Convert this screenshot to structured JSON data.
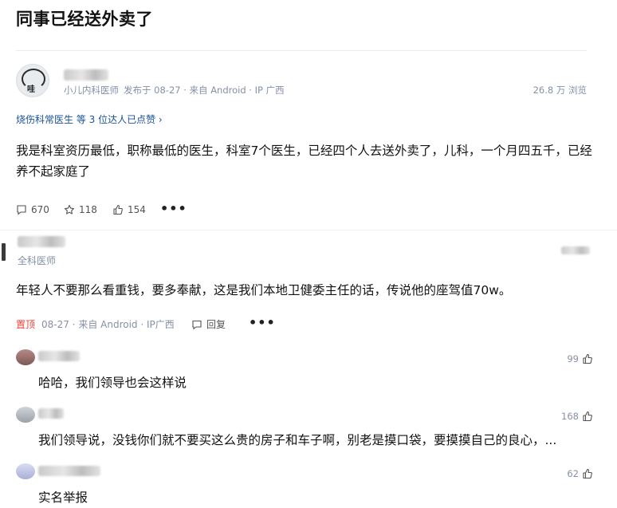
{
  "page": {
    "title": "同事已经送外卖了"
  },
  "post": {
    "author_role": "小儿内科医师",
    "published": "发布于 08-27 · 来自 Android · IP 广西",
    "views": "26.8 万 浏览",
    "avatar_badge": "哇",
    "liked_by": "烧伤科常医生 等 3 位达人已点赞",
    "liked_by_chevron": "›",
    "content": "我是科室资历最低，职称最低的医生，科室7个医生，已经四个人去送外卖了，儿科，一个月四五千，已经养不起家庭了",
    "comments_count": "670",
    "favorites_count": "118",
    "likes_count": "154",
    "more": "•••"
  },
  "comment": {
    "author_role": "全科医师",
    "content": "年轻人不要那么看重钱，要多奉献，这是我们本地卫健委主任的话，传说他的座驾值70w。",
    "pinned_label": "置顶",
    "meta": "08-27 · 来自 Android · IP广西",
    "reply_label": "回复",
    "more": "•••"
  },
  "replies": [
    {
      "content": "哈哈，我们领导也会这样说",
      "likes": "99"
    },
    {
      "content": "我们领导说，没钱你们就不要买这么贵的房子和车子啊，别老是摸口袋，要摸摸自己的良心，...",
      "likes": "168"
    },
    {
      "content": "实名举报",
      "likes": "62"
    }
  ],
  "colors": {
    "accent": "#175199",
    "meta": "#8590a6",
    "pin": "#f1403c"
  }
}
